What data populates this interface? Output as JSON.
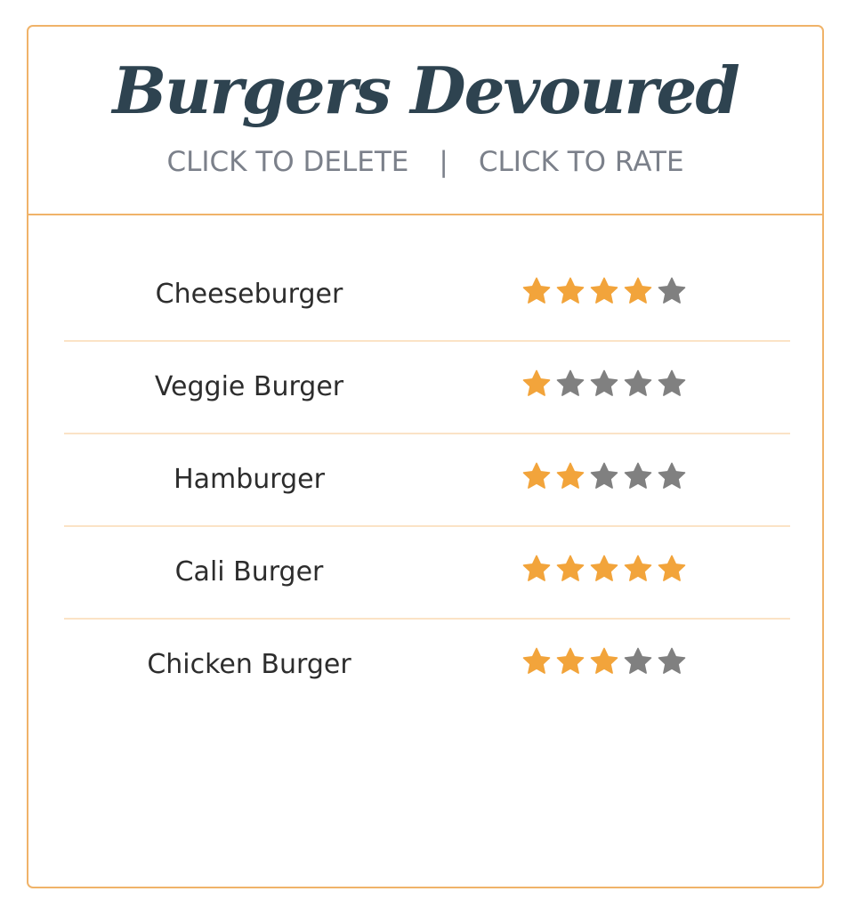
{
  "header": {
    "title": "Burgers Devoured",
    "delete_label": "CLICK TO DELETE",
    "separator": "|",
    "rate_label": "CLICK TO RATE"
  },
  "colors": {
    "border": "#f0b369",
    "star_filled": "#f2a43b",
    "star_empty": "#808080",
    "title": "#2e4350",
    "divider": "#fbe3c6"
  },
  "rating_max": 5,
  "burgers": [
    {
      "name": "Cheeseburger",
      "rating": 4
    },
    {
      "name": "Veggie Burger",
      "rating": 1
    },
    {
      "name": "Hamburger",
      "rating": 2
    },
    {
      "name": "Cali Burger",
      "rating": 5
    },
    {
      "name": "Chicken Burger",
      "rating": 3
    }
  ]
}
